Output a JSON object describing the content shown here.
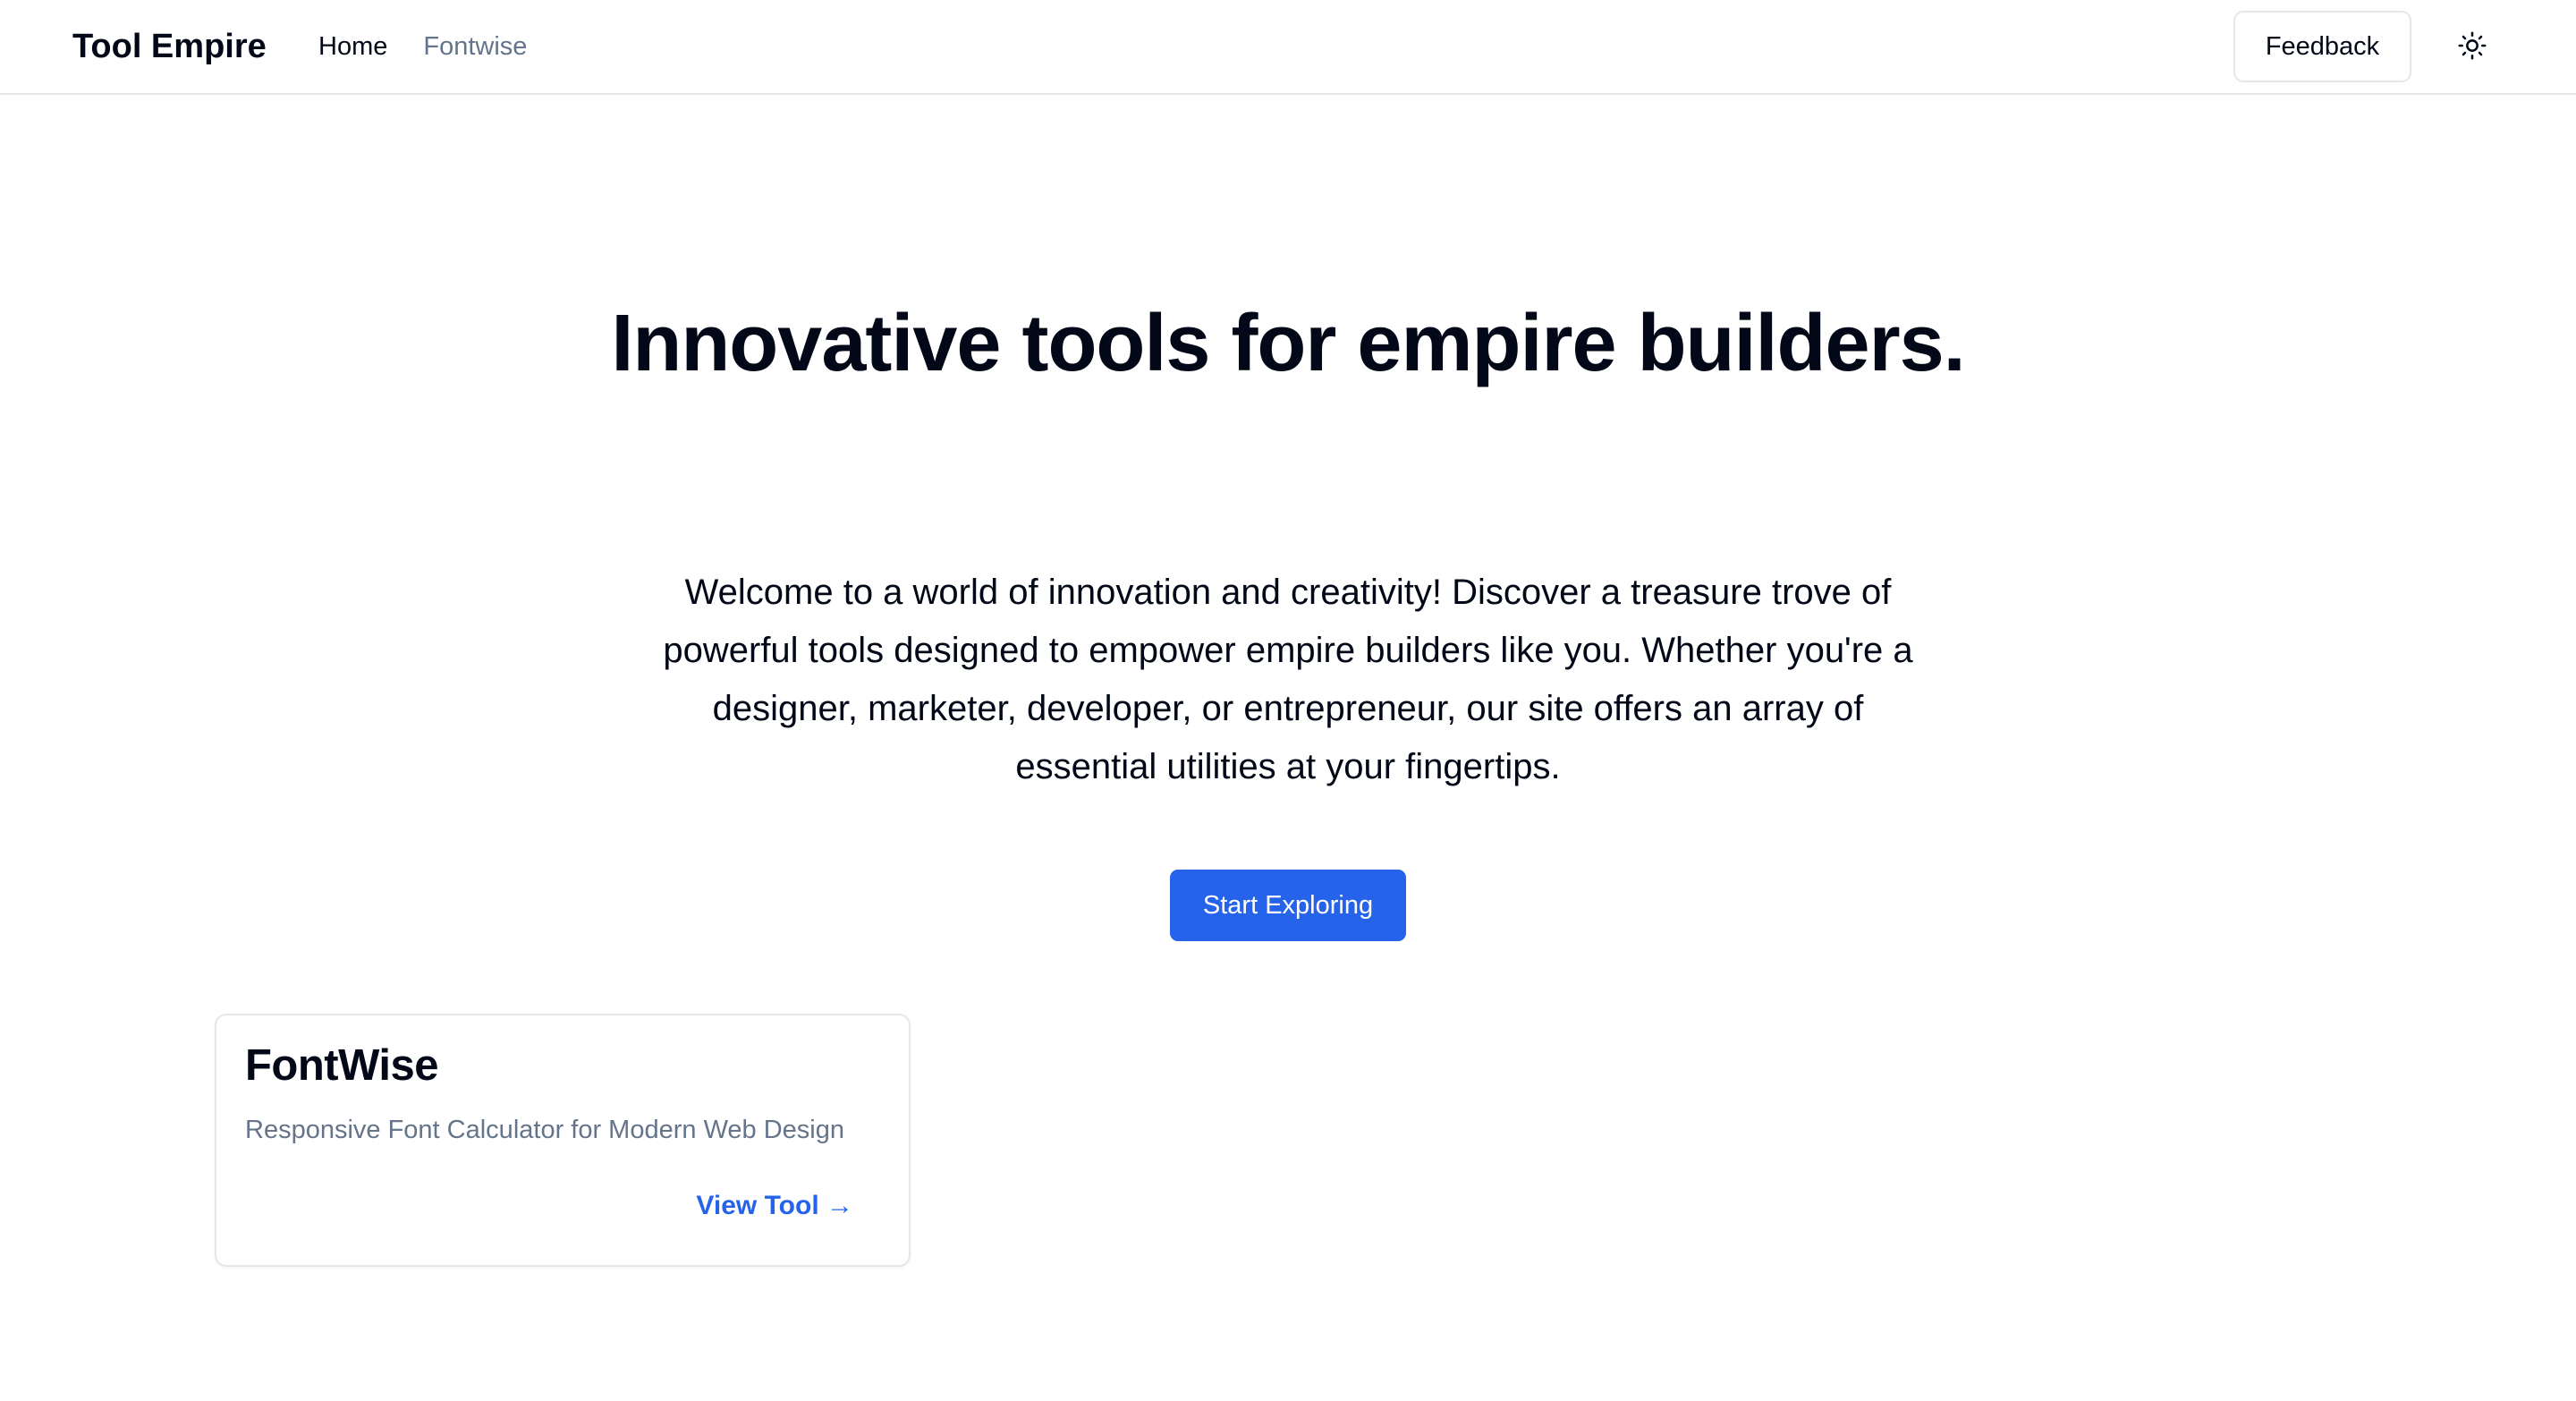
{
  "header": {
    "brand": "Tool Empire",
    "nav": [
      {
        "label": "Home"
      },
      {
        "label": "Fontwise"
      }
    ],
    "feedback_label": "Feedback",
    "theme_toggle_icon": "sun-icon"
  },
  "hero": {
    "title": "Innovative tools for empire builders.",
    "description": "Welcome to a world of innovation and creativity! Discover a treasure trove of powerful tools designed to empower empire builders like you. Whether you're a designer, marketer, developer, or entrepreneur, our site offers an array of essential utilities at your fingertips.",
    "cta_label": "Start Exploring"
  },
  "tools": [
    {
      "title": "FontWise",
      "description": "Responsive Font Calculator for Modern Web Design",
      "link_label": "View Tool →"
    }
  ],
  "colors": {
    "accent": "#2563eb",
    "text": "#020817",
    "muted": "#64748b",
    "border": "#e5e7eb"
  }
}
